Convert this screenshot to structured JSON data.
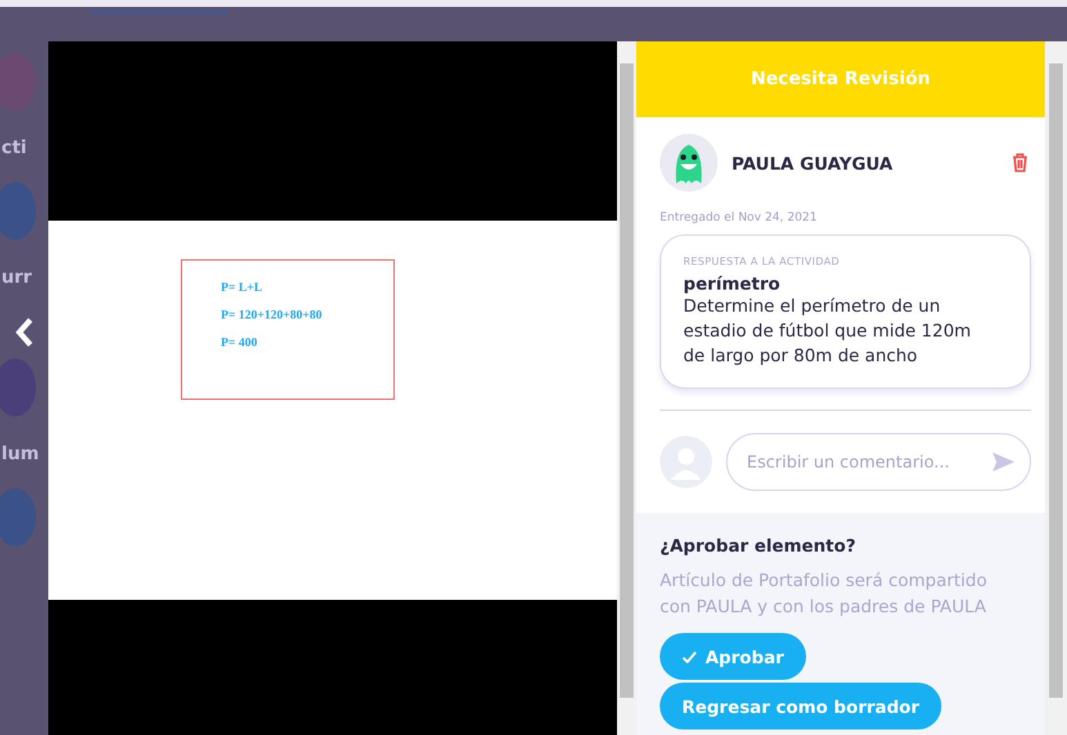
{
  "background": {
    "fragments": [
      "cti",
      "urr",
      "lum"
    ]
  },
  "image": {
    "lines": [
      "P= L+L",
      "P= 120+120+80+80",
      "P= 400"
    ]
  },
  "panel": {
    "status": "Necesita Revisión",
    "student": {
      "name": "PAULA GUAYGUA",
      "submitted": "Entregado el Nov 24, 2021"
    },
    "response": {
      "label": "RESPUESTA A LA ACTIVIDAD",
      "title": "perímetro",
      "text": "Determine el perímetro de un estadio de fútbol que mide 120m de largo por 80m de ancho"
    },
    "comment": {
      "placeholder": "Escribir un comentario..."
    },
    "approval": {
      "title": "¿Aprobar elemento?",
      "text": "Artículo de Portafolio será compartido con PAULA y con los padres de PAULA",
      "buttons": [
        {
          "kind": "approve",
          "label": "Aprobar"
        },
        {
          "kind": "plain",
          "label": "Regresar como borrador"
        }
      ]
    }
  }
}
